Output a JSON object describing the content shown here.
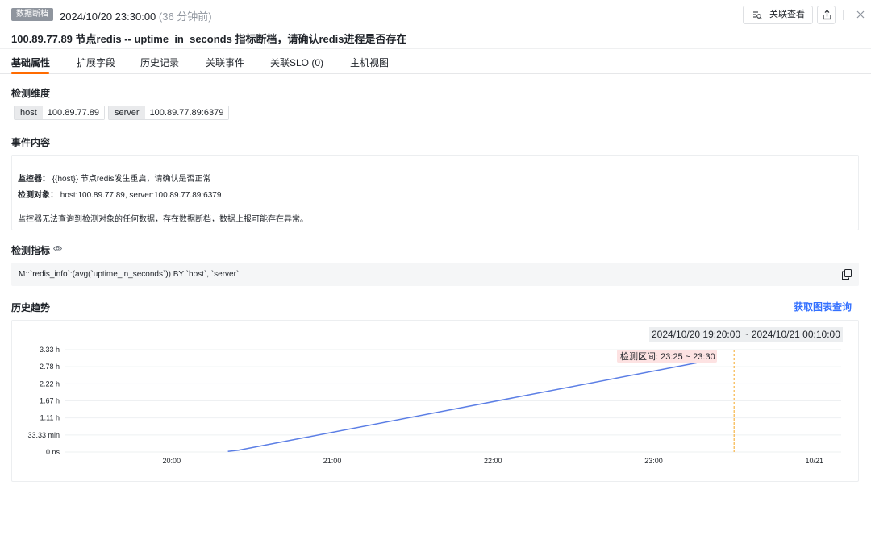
{
  "header": {
    "badge": "数据断档",
    "time": "2024/10/20 23:30:00",
    "ago": "(36 分钟前)",
    "related_button": "关联查看",
    "share_icon": "share-icon",
    "close_icon": "close-icon"
  },
  "title": "100.89.77.89 节点redis -- uptime_in_seconds 指标断档，请确认redis进程是否存在",
  "tabs": [
    {
      "label": "基础属性",
      "active": true
    },
    {
      "label": "扩展字段",
      "active": false
    },
    {
      "label": "历史记录",
      "active": false
    },
    {
      "label": "关联事件",
      "active": false
    },
    {
      "label": "关联SLO (0)",
      "active": false
    },
    {
      "label": "主机视图",
      "active": false
    }
  ],
  "dimensions": {
    "heading": "检测维度",
    "tags": [
      {
        "key": "host",
        "value": "100.89.77.89"
      },
      {
        "key": "server",
        "value": "100.89.77.89:6379"
      }
    ]
  },
  "event_content": {
    "heading": "事件内容",
    "monitor_label": "监控器：",
    "monitor_value": "{{host}} 节点redis发生重启，请确认是否正常",
    "target_label": "检测对象：",
    "target_value": "host:100.89.77.89, server:100.89.77.89:6379",
    "message": "监控器无法查询到检测对象的任何数据，存在数据断档，数据上报可能存在异常。"
  },
  "metric": {
    "heading": "检测指标",
    "query": "M::`redis_info`:(avg(`uptime_in_seconds`)) BY `host`, `server`"
  },
  "history": {
    "heading": "历史趋势",
    "get_query_link": "获取图表查询",
    "range": "2024/10/20 19:20:00 ~ 2024/10/21 00:10:00",
    "detect_window": "检测区间: 23:25 ~ 23:30"
  },
  "colors": {
    "accent": "#3370ff",
    "tab_active": "#ff6b00",
    "line": "#5b7ee5",
    "detect_marker": "#f5a623",
    "detect_label_bg": "#fde2e2"
  },
  "chart_data": {
    "type": "line",
    "x_ticks": [
      "20:00",
      "21:00",
      "22:00",
      "23:00",
      "10/21"
    ],
    "y_ticks": [
      "0 ns",
      "33.33 min",
      "1.11 h",
      "1.67 h",
      "2.22 h",
      "2.78 h",
      "3.33 h"
    ],
    "xlim": [
      "19:20",
      "00:10"
    ],
    "ylim_hours": [
      0,
      3.33
    ],
    "grid": true,
    "series": [
      {
        "x": [
          "20:21",
          "20:25",
          "23:16"
        ],
        "y_hours": [
          0.02,
          0.06,
          2.9
        ]
      }
    ],
    "detect_marker_x": "23:30"
  }
}
